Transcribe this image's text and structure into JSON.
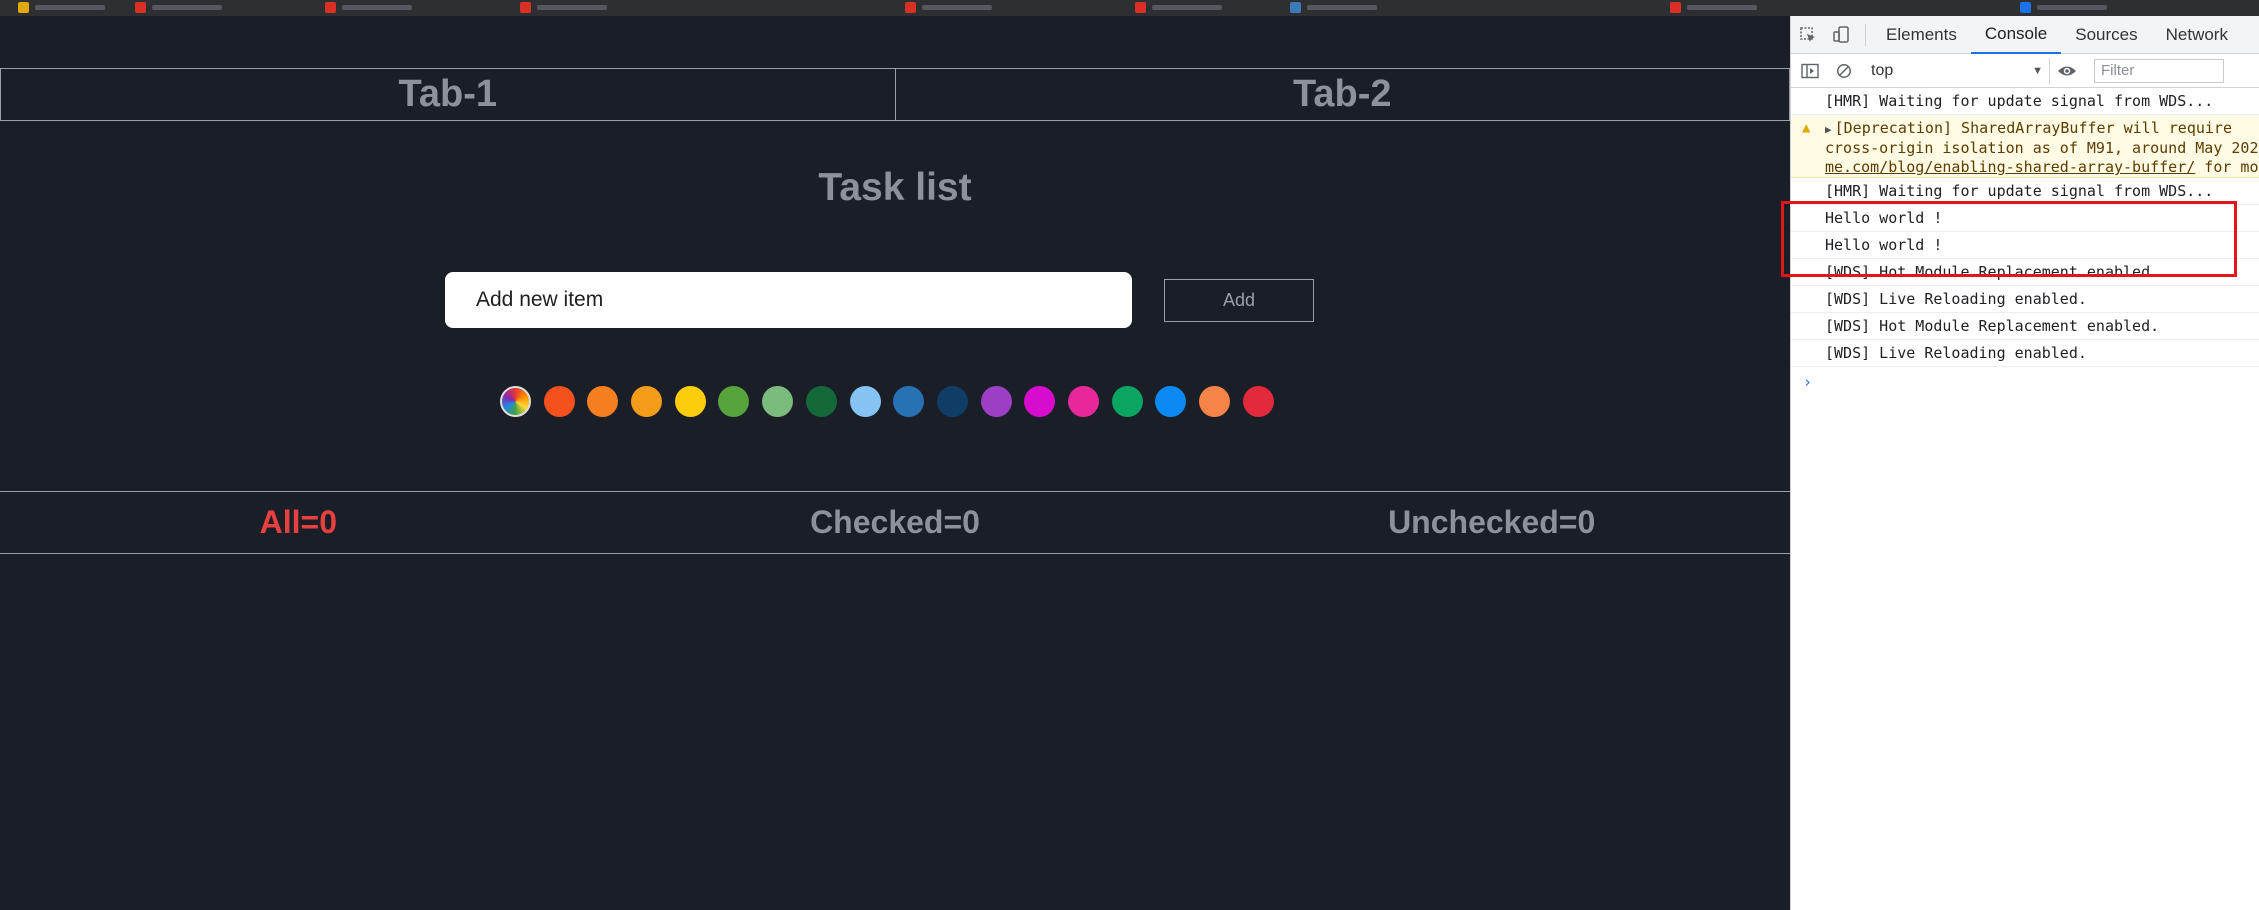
{
  "app": {
    "tabs": [
      {
        "label": "Tab-1"
      },
      {
        "label": "Tab-2"
      }
    ],
    "title": "Task list",
    "input": {
      "value": "",
      "placeholder": "Add new item"
    },
    "add_button": "Add",
    "swatch_colors": [
      "#f4511e",
      "#f6801f",
      "#f59c1a",
      "#fbcd0b",
      "#57a33c",
      "#7cbb7e",
      "#14693a",
      "#84c3f3",
      "#2771b4",
      "#0f3d66",
      "#9c3fc5",
      "#d80ccf",
      "#e8279a",
      "#0aa561",
      "#0b89f2",
      "#f78447",
      "#e3293c"
    ],
    "filters": [
      {
        "label": "All=0",
        "active": true
      },
      {
        "label": "Checked=0",
        "active": false
      },
      {
        "label": "Unchecked=0",
        "active": false
      }
    ]
  },
  "devtools": {
    "tabs": [
      {
        "label": "Elements",
        "active": false
      },
      {
        "label": "Console",
        "active": true
      },
      {
        "label": "Sources",
        "active": false
      },
      {
        "label": "Network",
        "active": false
      }
    ],
    "context": "top",
    "filter_placeholder": "Filter",
    "warning": {
      "line1": "[Deprecation] SharedArrayBuffer will require",
      "line2": "cross-origin isolation as of M91, around May 202",
      "link": "me.com/blog/enabling-shared-array-buffer/",
      "line3_tail": " for mo"
    },
    "logs": [
      "[HMR] Waiting for update signal from WDS...",
      "[HMR] Waiting for update signal from WDS...",
      "Hello world !",
      "Hello world !",
      "[WDS] Hot Module Replacement enabled.",
      "[WDS] Live Reloading enabled.",
      "[WDS] Hot Module Replacement enabled.",
      "[WDS] Live Reloading enabled."
    ],
    "prompt_symbol": "›"
  },
  "colors": {
    "background": "#1a1e26",
    "active_filter": "#e84040",
    "highlight_box": "#e3151c",
    "devtools_accent": "#1a73e8"
  }
}
